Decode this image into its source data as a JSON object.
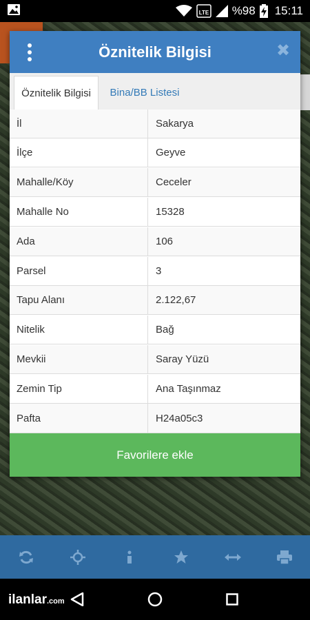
{
  "status_bar": {
    "network_label": "LTE",
    "battery": "%98",
    "time": "15:11"
  },
  "dialog": {
    "title": "Öznitelik Bilgisi",
    "close_label": "✖",
    "tabs": [
      {
        "label": "Öznitelik Bilgisi",
        "active": true
      },
      {
        "label": "Bina/BB Listesi",
        "active": false
      }
    ],
    "rows": [
      {
        "key": "İl",
        "value": "Sakarya"
      },
      {
        "key": "İlçe",
        "value": "Geyve"
      },
      {
        "key": "Mahalle/Köy",
        "value": "Ceceler"
      },
      {
        "key": "Mahalle No",
        "value": "15328"
      },
      {
        "key": "Ada",
        "value": "106"
      },
      {
        "key": "Parsel",
        "value": "3"
      },
      {
        "key": "Tapu Alanı",
        "value": "2.122,67"
      },
      {
        "key": "Nitelik",
        "value": "Bağ"
      },
      {
        "key": "Mevkii",
        "value": "Saray Yüzü"
      },
      {
        "key": "Zemin Tip",
        "value": "Ana Taşınmaz"
      },
      {
        "key": "Pafta",
        "value": "H24a05c3"
      }
    ],
    "favorite_button": "Favorilere ekle"
  },
  "toolbar": {
    "icons": [
      "refresh-icon",
      "crosshair-icon",
      "info-icon",
      "star-icon",
      "measure-icon",
      "print-icon"
    ]
  },
  "navbar": {
    "brand_main": "ilanlar",
    "brand_suffix": ".com"
  },
  "colors": {
    "header": "#3f7fc1",
    "favorite": "#5cb85c",
    "toolbar": "#2f6aa0",
    "tab_link": "#337ab7"
  }
}
